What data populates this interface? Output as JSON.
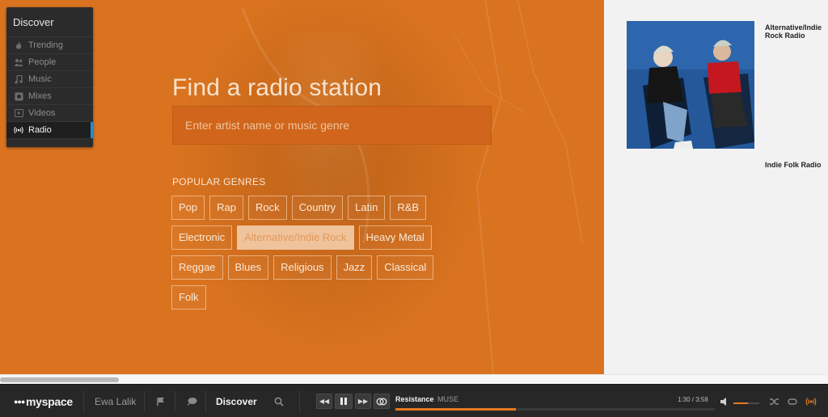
{
  "discover_menu": {
    "title": "Discover",
    "items": [
      {
        "label": "Trending",
        "icon": "flame-icon",
        "active": false
      },
      {
        "label": "People",
        "icon": "people-icon",
        "active": false
      },
      {
        "label": "Music",
        "icon": "music-note-icon",
        "active": false
      },
      {
        "label": "Mixes",
        "icon": "mixes-icon",
        "active": false
      },
      {
        "label": "Videos",
        "icon": "video-icon",
        "active": false
      },
      {
        "label": "Radio",
        "icon": "radio-icon",
        "active": true
      }
    ]
  },
  "hero": {
    "title": "Find a radio station",
    "search_placeholder": "Enter artist name or music genre",
    "search_value": "",
    "genres_heading": "POPULAR GENRES",
    "genre_rows": [
      [
        "Pop",
        "Rap",
        "Rock",
        "Country",
        "Latin",
        "R&B"
      ],
      [
        "Electronic",
        "Alternative/Indie Rock",
        "Heavy Metal"
      ],
      [
        "Reggae",
        "Blues",
        "Religious",
        "Jazz",
        "Classical"
      ],
      [
        "Folk"
      ]
    ],
    "active_genre": "Alternative/Indie Rock",
    "accent_color": "#d9731f"
  },
  "right_panel": {
    "stations": [
      {
        "name": "Alternative/Indie Rock Radio"
      },
      {
        "name": "Indie Folk Radio"
      }
    ]
  },
  "player": {
    "logo_text": "myspace",
    "username": "Ewa Lalik",
    "discover_label": "Discover",
    "track_title": "Resistance",
    "track_artist": "MUSE",
    "time_display": "1:30 / 3:58",
    "progress_fraction": 0.378,
    "volume_fraction": 0.55,
    "accent_color": "#e57a1f"
  }
}
